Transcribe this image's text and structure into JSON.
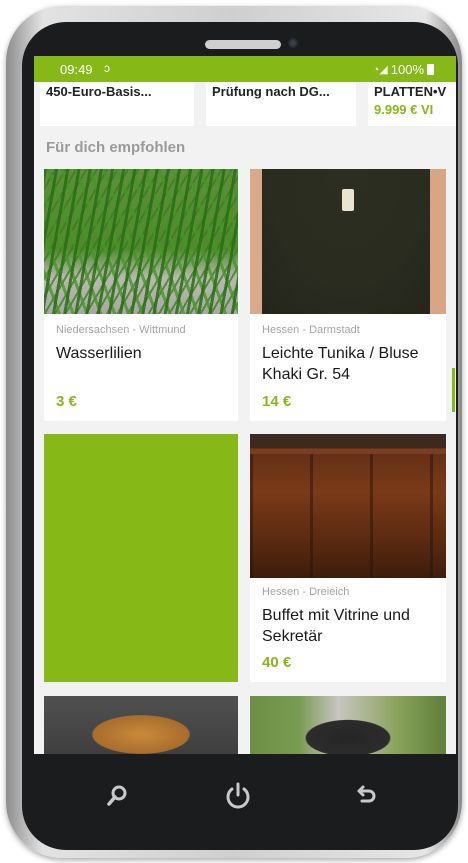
{
  "status_bar": {
    "time": "09:49",
    "battery": "100%"
  },
  "top_row": {
    "cards": [
      {
        "title": "450-Euro-Basis..."
      },
      {
        "title": "Prüfung nach DG..."
      },
      {
        "title": "PLATTEN•V",
        "price": "9.999 € VI"
      }
    ]
  },
  "section": {
    "title": "Für dich empfohlen"
  },
  "listings": [
    {
      "location": "Niedersachsen - Wittmund",
      "title": "Wasserlilien",
      "price": "3 €"
    },
    {
      "location": "Hessen - Darmstadt",
      "title": "Leichte Tunika / Bluse Khaki Gr. 54",
      "price": "14 €"
    },
    {
      "location": "Hessen - Dreieich",
      "title": "Buffet mit Vitrine und Sekretär",
      "price": "40 €"
    }
  ],
  "colors": {
    "accent": "#86b817",
    "background": "#f2f2f2",
    "phone_body": "#1b1c1d"
  },
  "icons": {
    "search": "search-icon",
    "power": "power-icon",
    "back": "back-icon"
  }
}
